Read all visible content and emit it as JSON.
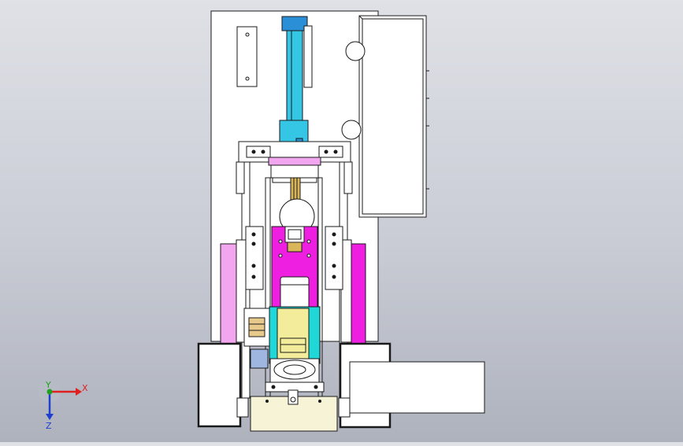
{
  "viewport": {
    "background_top": "#dfe1e6",
    "background_bottom": "#aeb2bd"
  },
  "triad": {
    "x_label": "X",
    "y_label": "Y",
    "z_label": "Z",
    "x_color": "#e02020",
    "y_color": "#1fa11f",
    "z_color": "#1f3fd0"
  },
  "colors": {
    "cylinder": "#35c6e6",
    "cylinder_cap": "#2a8fd6",
    "piston_rod": "#d9b65a",
    "magenta_panel": "#ee1fe0",
    "pink_plate": "#f3a6f0",
    "cyan_frame": "#1fd7d7",
    "yellow_block": "#f3ec9a",
    "cream_block": "#f7f3d6",
    "line": "#1a1a1a"
  }
}
